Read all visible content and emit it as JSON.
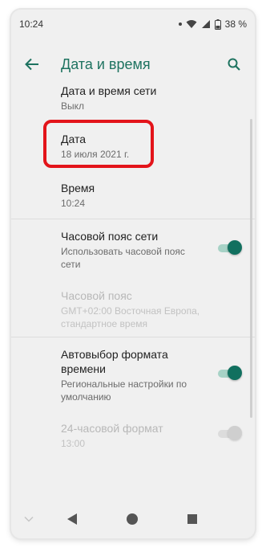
{
  "status_bar": {
    "time": "10:24",
    "battery": "38 %"
  },
  "app_bar": {
    "title": "Дата и время",
    "back_icon": "arrow-back-icon",
    "search_icon": "search-icon"
  },
  "settings": {
    "network_time": {
      "title": "Дата и время сети",
      "value": "Выкл"
    },
    "date": {
      "title": "Дата",
      "value": "18 июля 2021 г."
    },
    "time": {
      "title": "Время",
      "value": "10:24"
    },
    "network_timezone": {
      "title": "Часовой пояс сети",
      "value_line1": "Использовать часовой пояс",
      "value_line2": "сети",
      "enabled": true
    },
    "timezone": {
      "title": "Часовой пояс",
      "value_line1": "GMT+02:00 Восточная Европа,",
      "value_line2": "стандартное время",
      "disabled": true
    },
    "auto_format": {
      "title_line1": "Автовыбор формата",
      "title_line2": "времени",
      "value_line1": "Региональные настройки по",
      "value_line2": "умолчанию",
      "enabled": true
    },
    "format_24h": {
      "title": "24-часовой формат",
      "value": "13:00",
      "enabled": false,
      "disabled": true
    }
  },
  "colors": {
    "accent": "#1e7360",
    "toggle_on": "#11705f",
    "highlight": "#e3141a"
  }
}
